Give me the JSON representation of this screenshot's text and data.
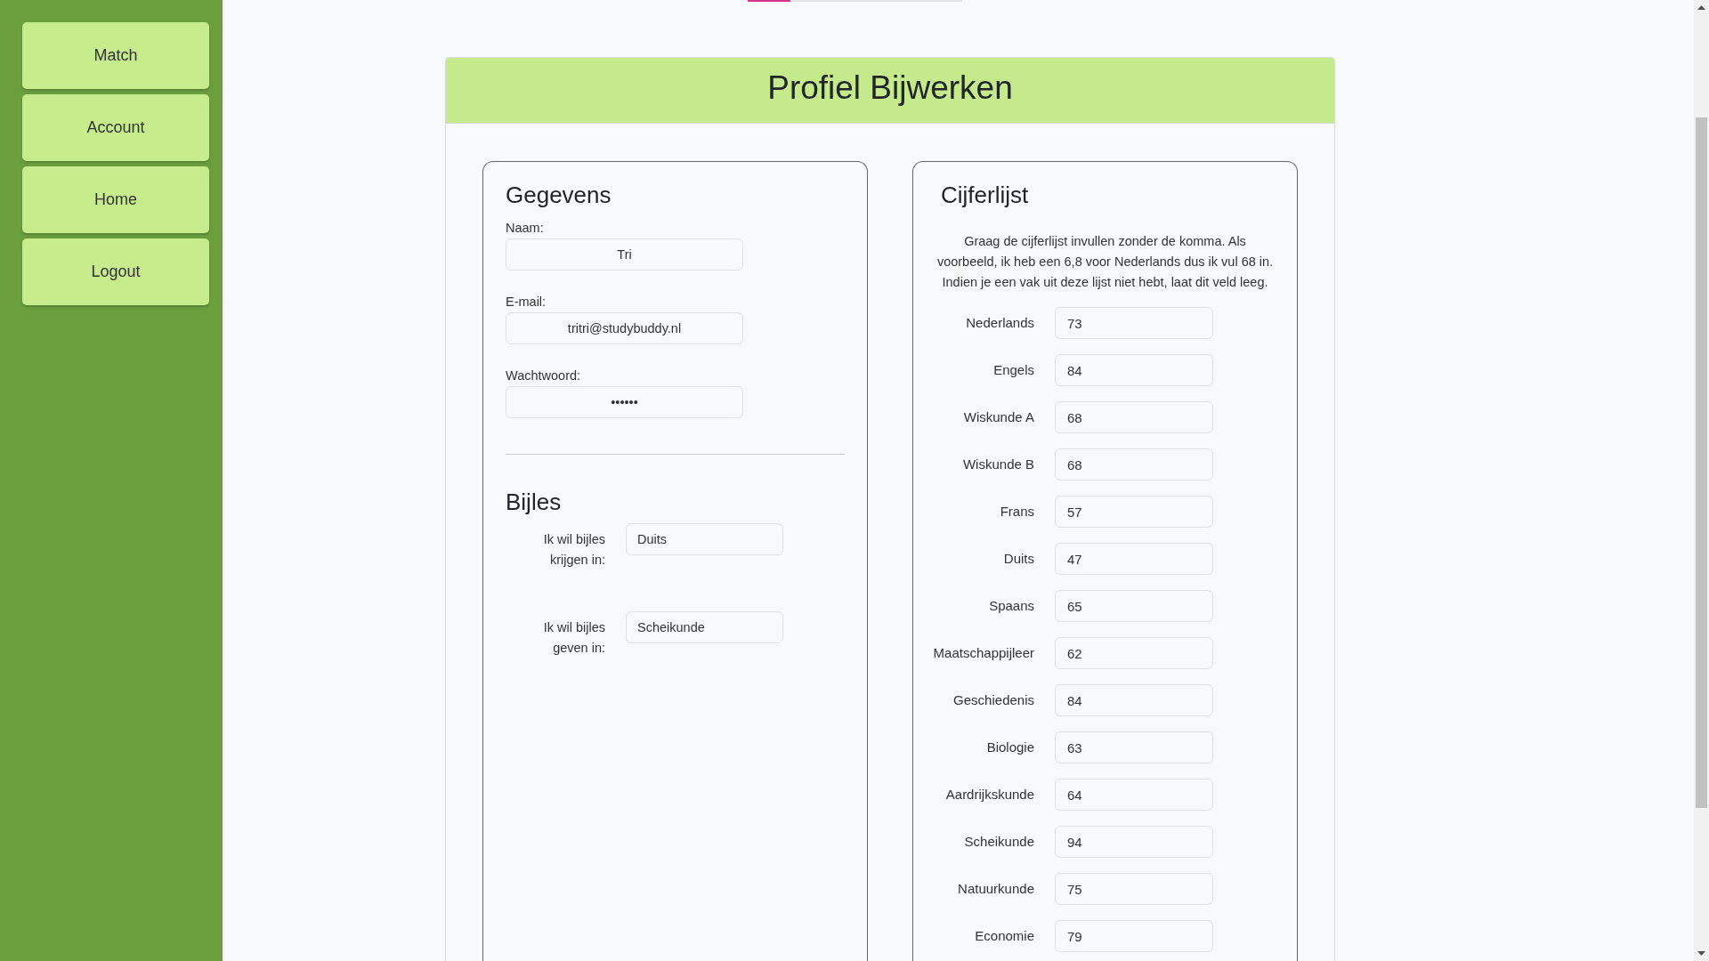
{
  "sidebar": {
    "items": [
      {
        "label": "Match"
      },
      {
        "label": "Account"
      },
      {
        "label": "Home"
      },
      {
        "label": "Logout"
      }
    ]
  },
  "progress": {
    "level": 0.2
  },
  "card": {
    "title": "Profiel Bijwerken"
  },
  "gegevens": {
    "title": "Gegevens",
    "fields": [
      {
        "label": "Naam:",
        "value": "Tri"
      },
      {
        "label": "E-mail:",
        "value": "tritri@studybuddy.nl"
      },
      {
        "label": "Wachtwoord:",
        "value": "••••••"
      }
    ]
  },
  "bijles": {
    "title": "Bijles",
    "fields": [
      {
        "label": "Ik wil bijles krijgen in:",
        "value": "Duits"
      },
      {
        "label": "Ik wil bijles geven in:",
        "value": "Scheikunde"
      }
    ]
  },
  "cijferlijst": {
    "title": "Cijferlijst",
    "intro": "Graag de cijferlijst invullen zonder de komma. Als voorbeeld, ik heb een 6,8 voor Nederlands dus ik vul 68 in. Indien je een vak uit deze lijst niet hebt, laat dit veld leeg.",
    "grades": [
      {
        "subject": "Nederlands",
        "value": "73"
      },
      {
        "subject": "Engels",
        "value": "84"
      },
      {
        "subject": "Wiskunde A",
        "value": "68"
      },
      {
        "subject": "Wiskunde B",
        "value": "68"
      },
      {
        "subject": "Frans",
        "value": "57"
      },
      {
        "subject": "Duits",
        "value": "47"
      },
      {
        "subject": "Spaans",
        "value": "65"
      },
      {
        "subject": "Maatschappijleer",
        "value": "62"
      },
      {
        "subject": "Geschiedenis",
        "value": "84"
      },
      {
        "subject": "Biologie",
        "value": "63"
      },
      {
        "subject": "Aardrijkskunde",
        "value": "64"
      },
      {
        "subject": "Scheikunde",
        "value": "94"
      },
      {
        "subject": "Natuurkunde",
        "value": "75"
      },
      {
        "subject": "Economie",
        "value": "79"
      }
    ]
  }
}
